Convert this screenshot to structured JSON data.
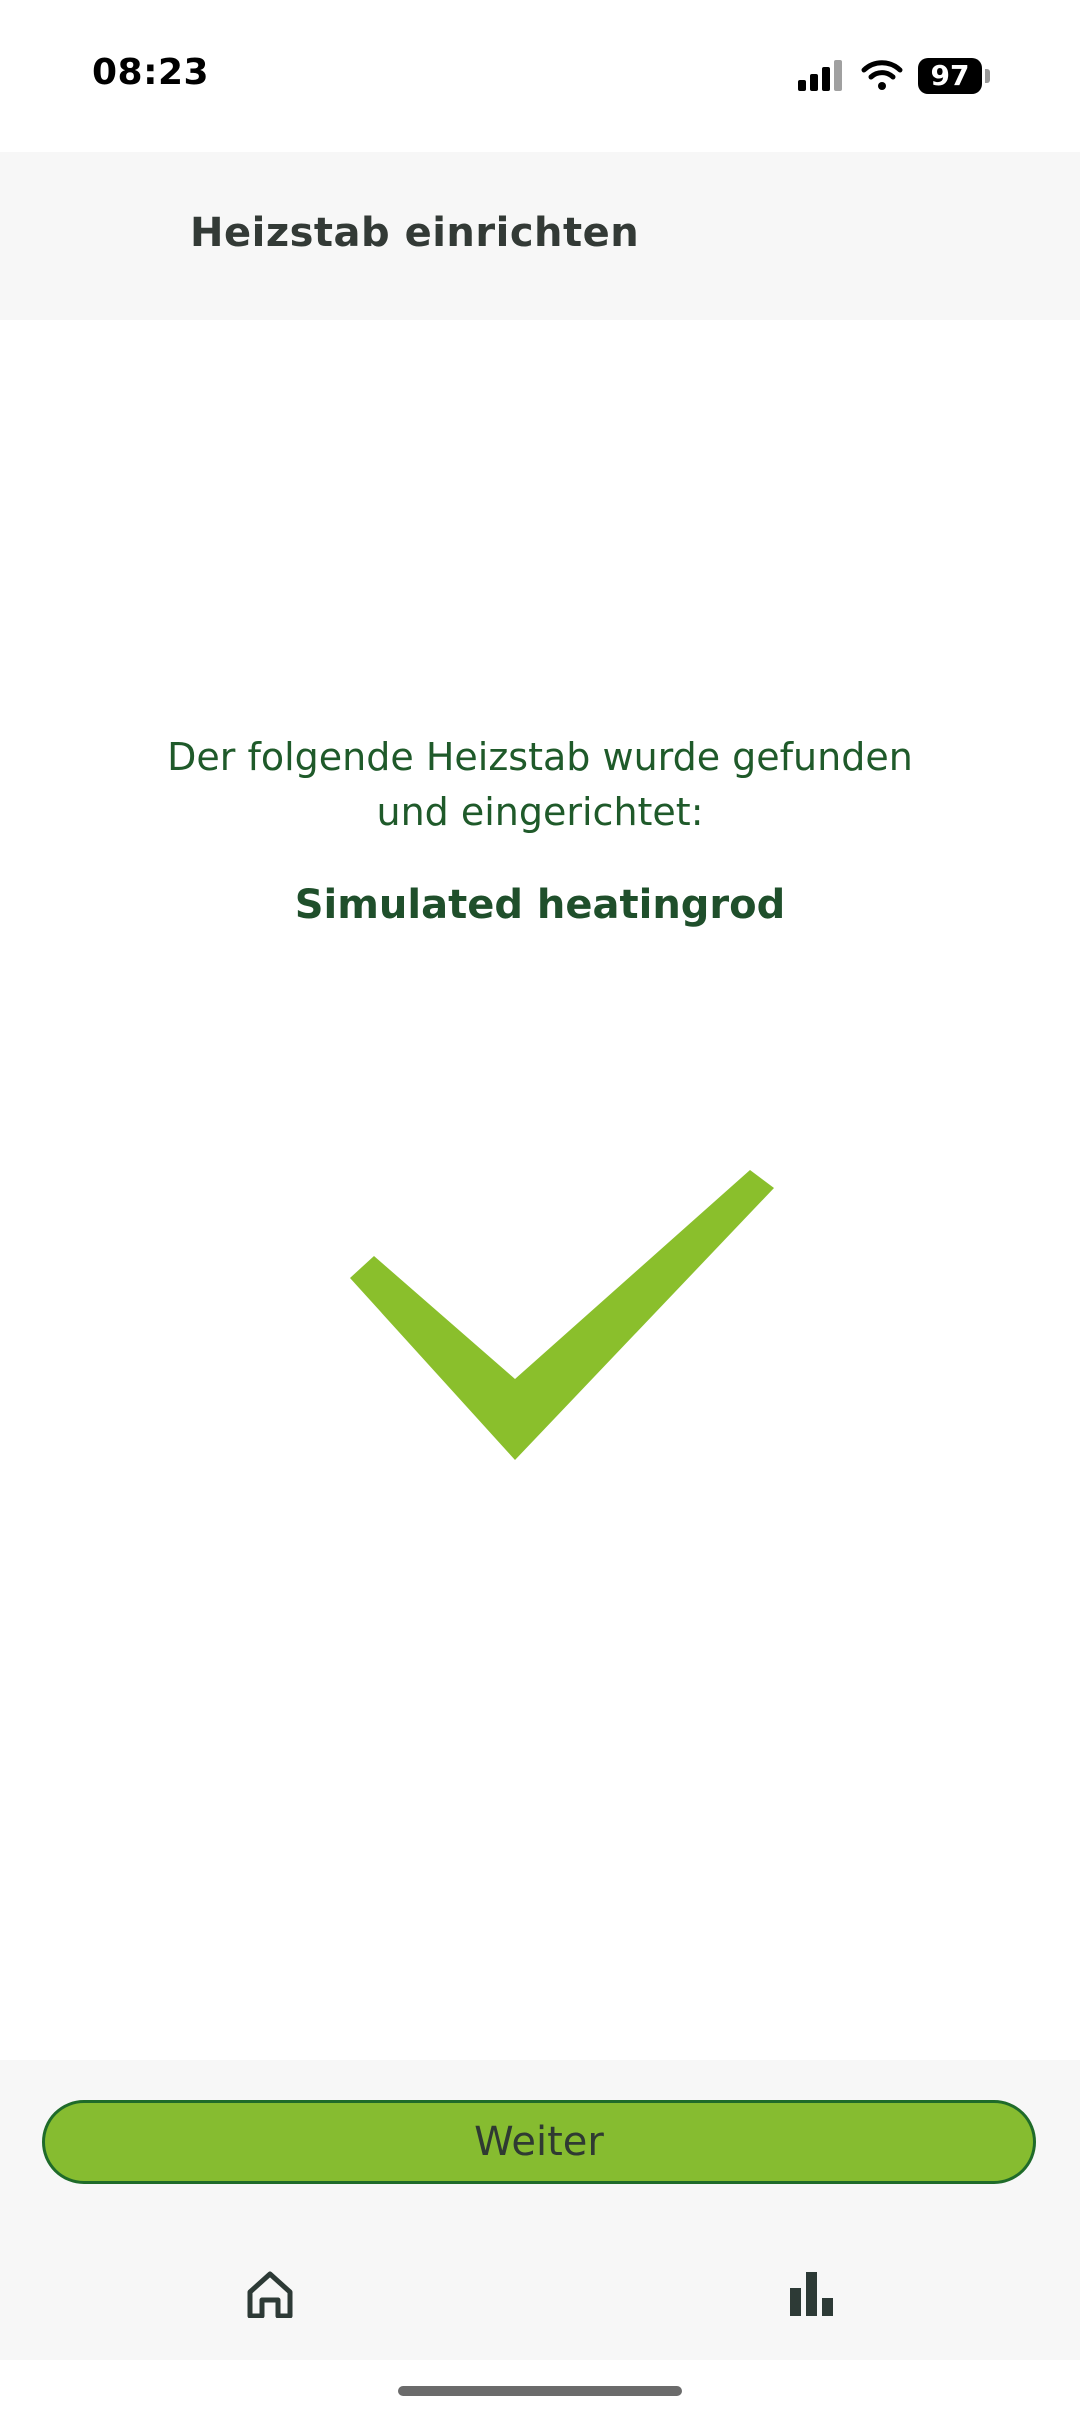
{
  "status_bar": {
    "time": "08:23",
    "battery_level": "97",
    "icons": [
      "signal-icon",
      "wifi-icon",
      "battery-icon"
    ]
  },
  "header": {
    "title": "Heizstab einrichten"
  },
  "main": {
    "message": "Der folgende Heizstab wurde gefunden und eingerichtet:",
    "device_name": "Simulated heatingrod",
    "status_icon": "checkmark-icon"
  },
  "footer": {
    "next_label": "Weiter"
  },
  "nav": {
    "items": [
      {
        "icon": "home-icon"
      },
      {
        "icon": "bar-chart-icon"
      }
    ]
  },
  "colors": {
    "accent_green": "#86bc30",
    "checkmark_green": "#8abf2c",
    "dark_green_text": "#1f5a2a",
    "header_bg": "#f7f7f7"
  }
}
